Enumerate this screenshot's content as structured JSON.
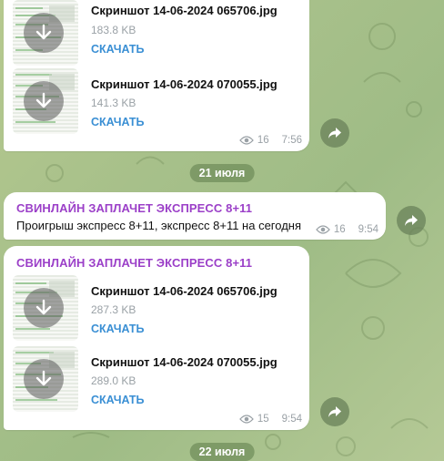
{
  "colors": {
    "channel": "#9b3fc8",
    "link": "#3a8fd4",
    "meta": "#9aa1a6"
  },
  "block1": {
    "files": [
      {
        "name": "Скриншот 14-06-2024 065706.jpg",
        "size": "183.8 KB",
        "action": "СКАЧАТЬ"
      },
      {
        "name": "Скриншот 14-06-2024 070055.jpg",
        "size": "141.3 KB",
        "action": "СКАЧАТЬ"
      }
    ],
    "views": "16",
    "time": "7:56"
  },
  "date1": "21 июля",
  "block2": {
    "channel": "СВИНЛАЙН ЗАПЛАЧЕТ ЭКСПРЕСС 8+11",
    "text": "Проигрыш экспресс 8+11, экспресс 8+11 на сегодня",
    "views": "16",
    "time": "9:54"
  },
  "block3": {
    "channel": "СВИНЛАЙН ЗАПЛАЧЕТ ЭКСПРЕСС 8+11",
    "files": [
      {
        "name": "Скриншот 14-06-2024 065706.jpg",
        "size": "287.3 KB",
        "action": "СКАЧАТЬ"
      },
      {
        "name": "Скриншот 14-06-2024 070055.jpg",
        "size": "289.0 KB",
        "action": "СКАЧАТЬ"
      }
    ],
    "views": "15",
    "time": "9:54"
  },
  "date2": "22 июля",
  "icons": {
    "download": "download-arrow-icon",
    "share": "share-arrow-icon",
    "views": "eye-icon"
  }
}
